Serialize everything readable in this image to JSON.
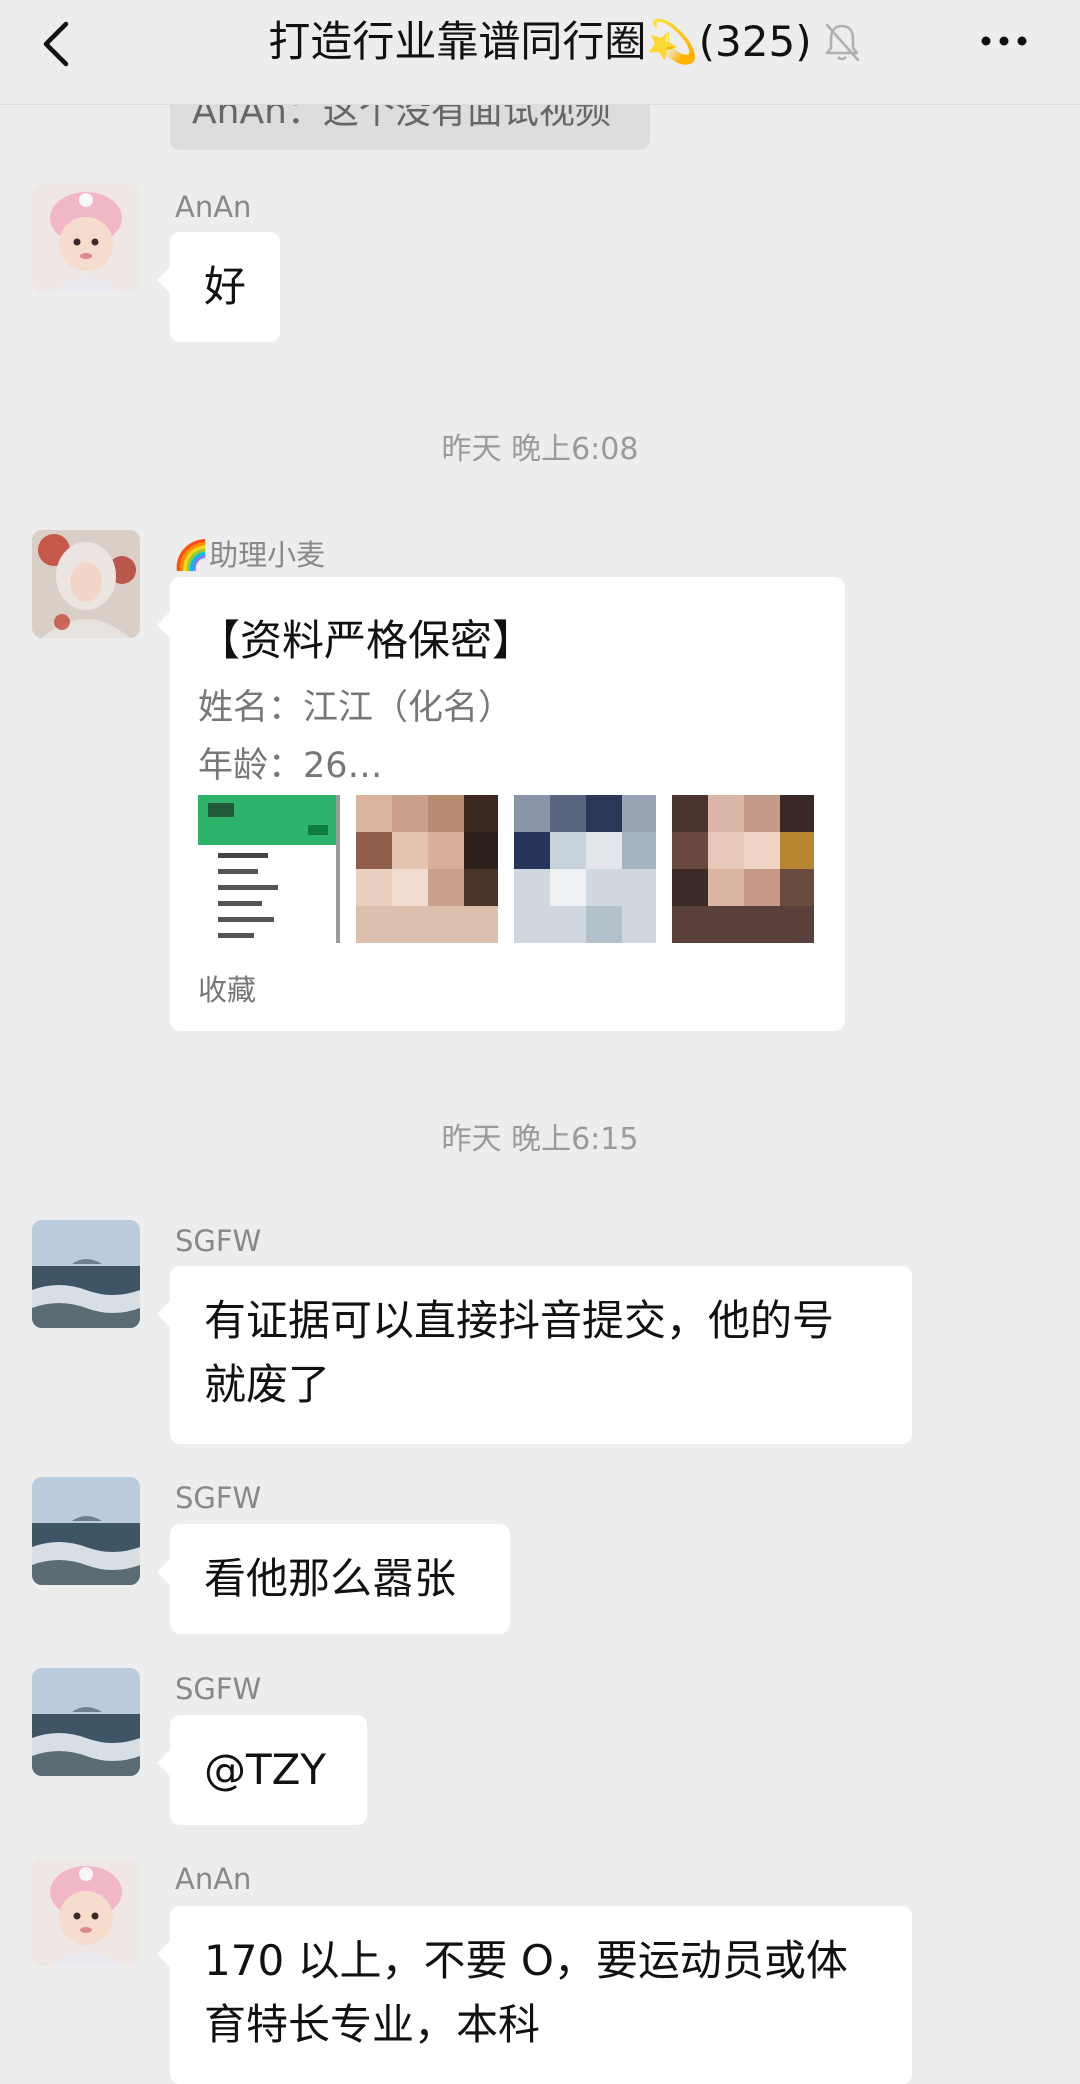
{
  "header": {
    "title": "打造行业靠谱同行圈💫(325)",
    "back_icon": "chevron-left-icon",
    "mute_icon": "bell-muted-icon",
    "more_icon": "more-dots-icon"
  },
  "cut_message": "AnAn：这个没有面试视频",
  "timestamps": [
    "昨天 晚上6:08",
    "昨天 晚上6:15"
  ],
  "messages": [
    {
      "sender": "AnAn",
      "lines": [
        "好"
      ]
    },
    {
      "sender": "🌈助理小麦"
    },
    {
      "sender": "SGFW",
      "lines": [
        "有证据可以直接抖音提交，他的号",
        "就废了"
      ]
    },
    {
      "sender": "SGFW",
      "lines": [
        "看他那么嚣张"
      ]
    },
    {
      "sender": "SGFW",
      "lines": [
        "@TZY"
      ]
    },
    {
      "sender": "AnAn",
      "lines": [
        "170 以上，不要 O，要运动员或体",
        "育特长专业，本科"
      ]
    }
  ],
  "favorite_card": {
    "title": "【资料严格保密】",
    "line1": "姓名：江江（化名）",
    "line2": "年龄：26…",
    "source": "收藏"
  },
  "colors": {
    "background": "#ededed",
    "bubble": "#ffffff",
    "meta_text": "#9a9a9a"
  }
}
